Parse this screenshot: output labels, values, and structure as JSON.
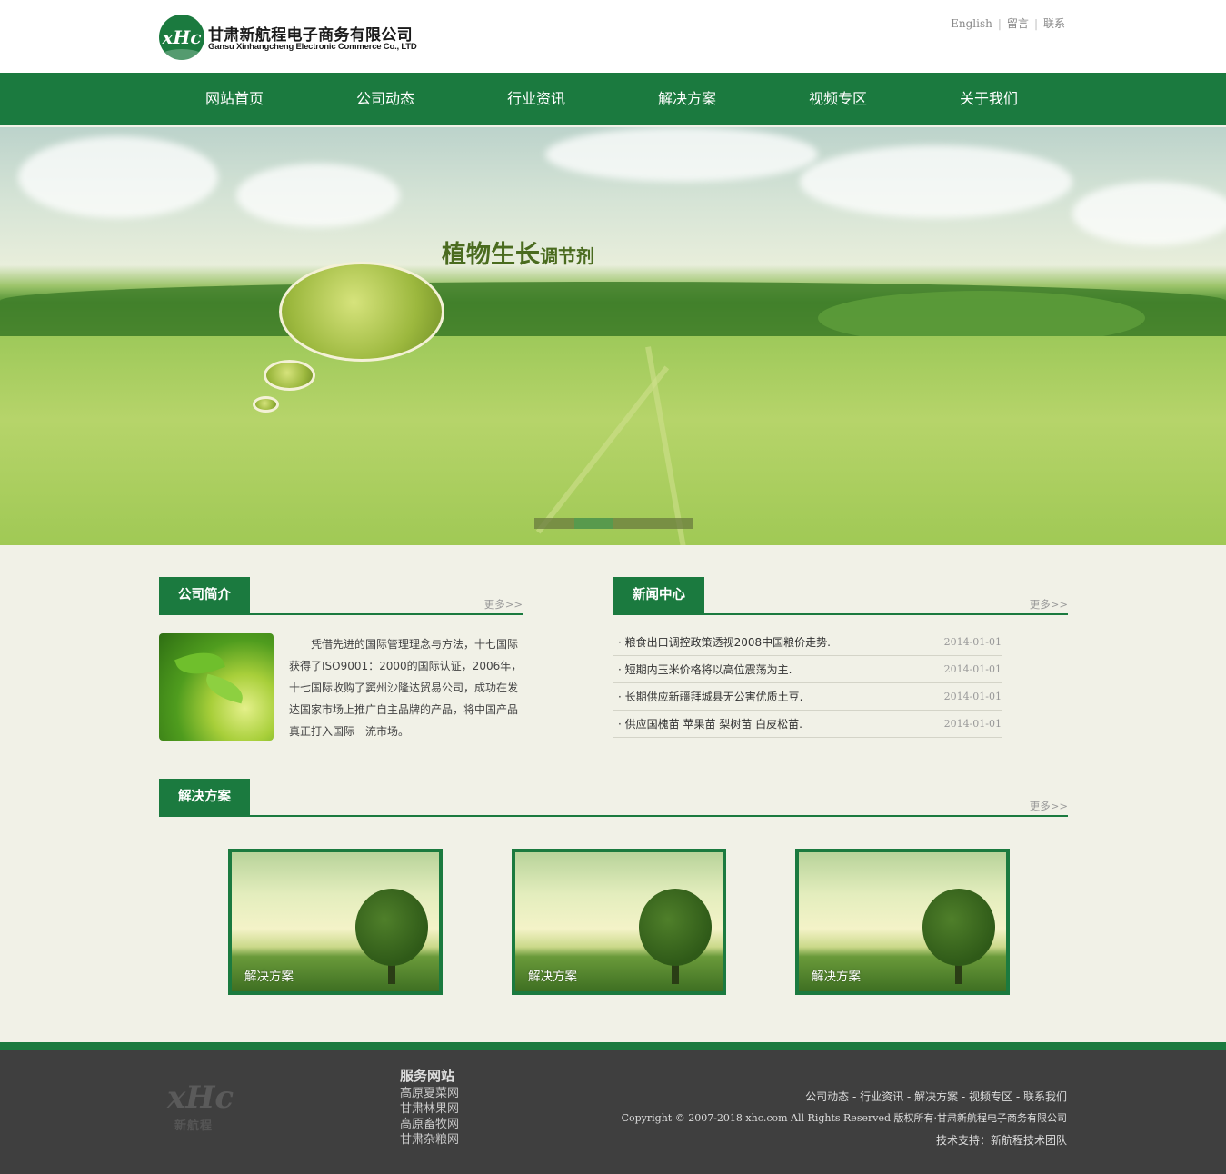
{
  "header": {
    "logo_badge": "xHc",
    "company_cn": "甘肃新航程电子商务有限公司",
    "company_en": "Gansu Xinhangcheng Electronic Commerce Co., LTD",
    "top_links": [
      "English",
      "留言",
      "联系"
    ]
  },
  "nav": {
    "items": [
      "网站首页",
      "公司动态",
      "行业资讯",
      "解决方案",
      "视频专区",
      "关于我们"
    ]
  },
  "banner": {
    "title_big": "植物生长",
    "title_small": "调节剂",
    "slides_total": 4,
    "active_slide": 2
  },
  "about": {
    "title": "公司简介",
    "more": "更多>>",
    "text": "凭借先进的国际管理理念与方法，十七国际获得了ISO9001：2000的国际认证，2006年，十七国际收购了窦州沙隆达贸易公司，成功在发达国家市场上推广自主品牌的产品，将中国产品真正打入国际一流市场。"
  },
  "news": {
    "title": "新闻中心",
    "more": "更多>>",
    "items": [
      {
        "title": "· 粮食出口调控政策透视2008中国粮价走势.",
        "date": "2014-01-01"
      },
      {
        "title": "· 短期内玉米价格将以高位震荡为主.",
        "date": "2014-01-01"
      },
      {
        "title": "· 长期供应新疆拜城县无公害优质土豆.",
        "date": "2014-01-01"
      },
      {
        "title": "· 供应国槐苗 苹果苗 梨树苗 白皮松苗.",
        "date": "2014-01-01"
      }
    ]
  },
  "solutions": {
    "title": "解决方案",
    "more": "更多>>",
    "cards": [
      "解决方案",
      "解决方案",
      "解决方案"
    ]
  },
  "footer": {
    "logo_text": "xHc",
    "logo_cn": "新航程",
    "links_title": "服务网站",
    "links": [
      "高原夏菜网",
      "甘肃林果网",
      "高原畜牧网",
      "甘肃杂粮网"
    ],
    "nav_line": "公司动态 - 行业资讯 - 解决方案 - 视频专区 - 联系我们",
    "copyright": "Copyright © 2007-2018 xhc.com All Rights Reserved 版权所有·甘肃新航程电子商务有限公司",
    "support": "技术支持：新航程技术团队"
  },
  "colors": {
    "brand_green": "#1b7a3f",
    "footer_bg": "#3f3f3f",
    "page_bg": "#f1f1e7"
  }
}
